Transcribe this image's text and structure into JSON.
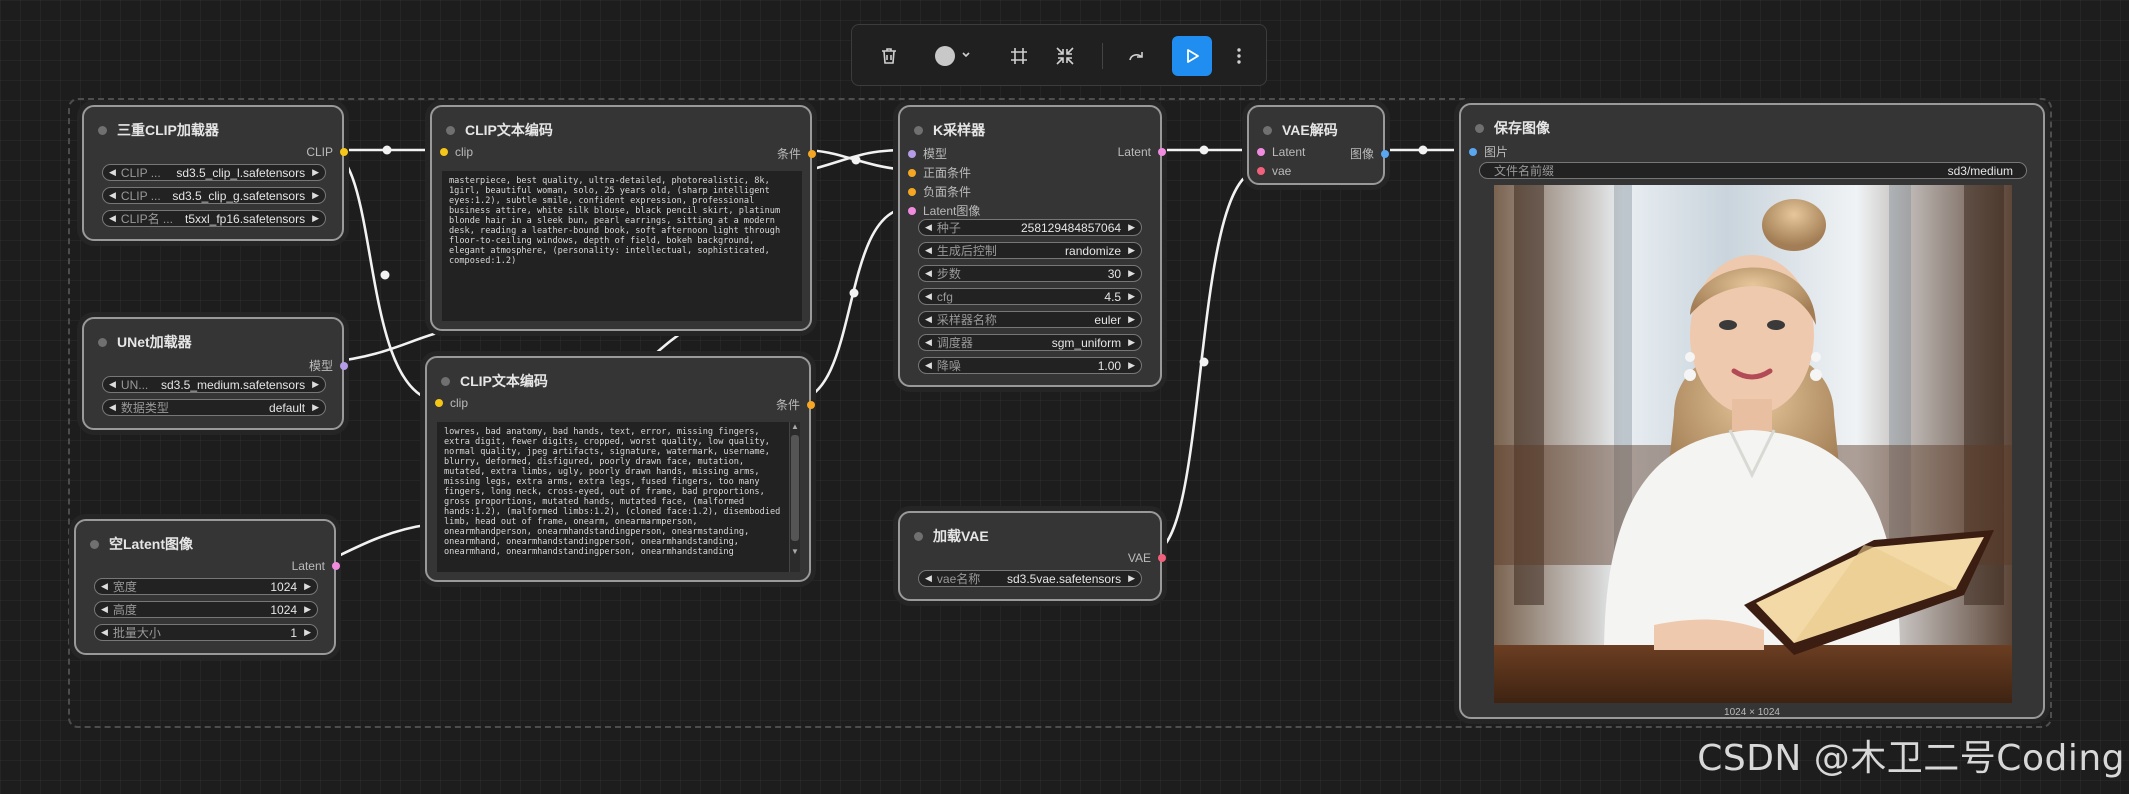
{
  "toolbar": {
    "icons": [
      "trash-icon",
      "color-dot-icon",
      "chevron-down-icon",
      "frame-icon",
      "collapse-icon",
      "redo-icon",
      "run-icon",
      "more-icon"
    ]
  },
  "nodes": {
    "triple_clip": {
      "title": "三重CLIP加载器",
      "output": "CLIP",
      "widgets": [
        {
          "label": "CLIP ...",
          "value": "sd3.5_clip_l.safetensors"
        },
        {
          "label": "CLIP ...",
          "value": "sd3.5_clip_g.safetensors"
        },
        {
          "label": "CLIP名 ...",
          "value": "t5xxl_fp16.safetensors"
        }
      ]
    },
    "unet": {
      "title": "UNet加载器",
      "output": "模型",
      "widgets": [
        {
          "label": "UN...",
          "value": "sd3.5_medium.safetensors"
        },
        {
          "label": "数据类型",
          "value": "default"
        }
      ]
    },
    "latent": {
      "title": "空Latent图像",
      "output": "Latent",
      "widgets": [
        {
          "label": "宽度",
          "value": "1024"
        },
        {
          "label": "高度",
          "value": "1024"
        },
        {
          "label": "批量大小",
          "value": "1"
        }
      ]
    },
    "clip_pos": {
      "title": "CLIP文本编码",
      "input": "clip",
      "output": "条件",
      "text": "masterpiece, best quality, ultra-detailed, photorealistic, 8k, 1girl, beautiful woman, solo, 25 years old, (sharp intelligent eyes:1.2), subtle smile, confident expression, professional business attire, white silk blouse, black pencil skirt, platinum blonde hair in a sleek bun, pearl earrings, sitting at a modern desk, reading a leather-bound book, soft afternoon light through floor-to-ceiling windows, depth of field, bokeh background, elegant atmosphere, (personality: intellectual, sophisticated, composed:1.2)"
    },
    "clip_neg": {
      "title": "CLIP文本编码",
      "input": "clip",
      "output": "条件",
      "text": "lowres, bad anatomy, bad hands, text, error, missing fingers, extra digit, fewer digits, cropped, worst quality, low quality, normal quality, jpeg artifacts, signature, watermark, username, blurry, deformed, disfigured, poorly drawn face, mutation, mutated, extra limbs, ugly, poorly drawn hands, missing arms, missing legs, extra arms, extra legs, fused fingers, too many fingers, long neck, cross-eyed, out of frame, bad proportions, gross proportions, mutated hands, mutated face, (malformed hands:1.2), (malformed limbs:1.2), (cloned face:1.2), disembodied limb, head out of frame, onearm, onearmarmperson, onearmhandperson, onearmhandstandingperson, onearmstanding, onearmhand, onearmhandstandingperson, onearmhandstanding, onearmhand, onearmhandstandingperson, onearmhandstanding"
    },
    "ksampler": {
      "title": "K采样器",
      "inputs": [
        "模型",
        "正面条件",
        "负面条件",
        "Latent图像"
      ],
      "output": "Latent",
      "widgets": [
        {
          "label": "种子",
          "value": "258129484857064"
        },
        {
          "label": "生成后控制",
          "value": "randomize"
        },
        {
          "label": "步数",
          "value": "30"
        },
        {
          "label": "cfg",
          "value": "4.5"
        },
        {
          "label": "采样器名称",
          "value": "euler"
        },
        {
          "label": "调度器",
          "value": "sgm_uniform"
        },
        {
          "label": "降噪",
          "value": "1.00"
        }
      ]
    },
    "vae_decode": {
      "title": "VAE解码",
      "inputs": [
        "Latent",
        "vae"
      ],
      "output": "图像"
    },
    "vae_loader": {
      "title": "加载VAE",
      "output": "VAE",
      "widgets": [
        {
          "label": "vae名称",
          "value": "sd3.5vae.safetensors"
        }
      ]
    },
    "save_image": {
      "title": "保存图像",
      "input": "图片",
      "widgets": [
        {
          "label": "文件名前缀",
          "value": "sd3/medium"
        }
      ],
      "image_size": "1024 × 1024"
    }
  },
  "colors": {
    "clip": "#f5c518",
    "conditioning": "#f5a623",
    "model": "#b59ce6",
    "latent": "#f08be0",
    "vae": "#f2607b",
    "image": "#5aa6f0",
    "run_button": "#1f8ef0"
  },
  "watermark": "CSDN @木卫二号Coding"
}
